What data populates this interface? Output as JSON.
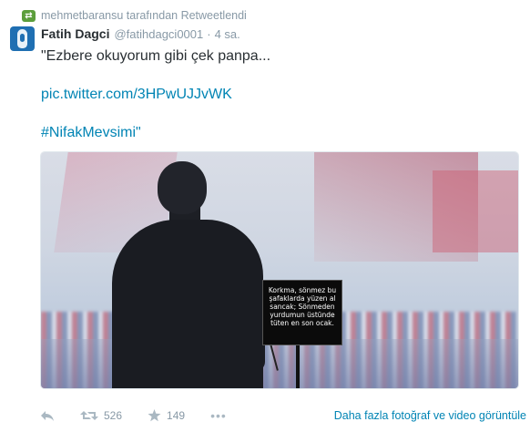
{
  "retweet": {
    "text": "mehmetbaransu tarafından Retweetlendi",
    "icon": "retweet-icon"
  },
  "tweet": {
    "fullname": "Fatih Dagci",
    "username": "@fatihdagci0001",
    "separator": "·",
    "time": "4 sa.",
    "text": "\"Ezbere okuyorum gibi çek panpa...",
    "link": "pic.twitter.com/3HPwUJJvWK",
    "hashtag": "#NifakMevsimi\""
  },
  "photo": {
    "prompter_text": "Korkma, sönmez bu şafaklarda yüzen al sancak; Sönmeden yurdumun üstünde tüten en son ocak."
  },
  "actions": {
    "reply_icon": "reply-icon",
    "retweet_icon": "retweet-icon",
    "retweet_count": "526",
    "favorite_icon": "star-icon",
    "favorite_count": "149",
    "more_label": "•••",
    "view_media": "Daha fazla fotoğraf ve video görüntüle"
  },
  "colors": {
    "link": "#0084b4",
    "meta": "#8899a6",
    "retweet_badge": "#5c9e3c",
    "avatar": "#1f6fb2"
  }
}
